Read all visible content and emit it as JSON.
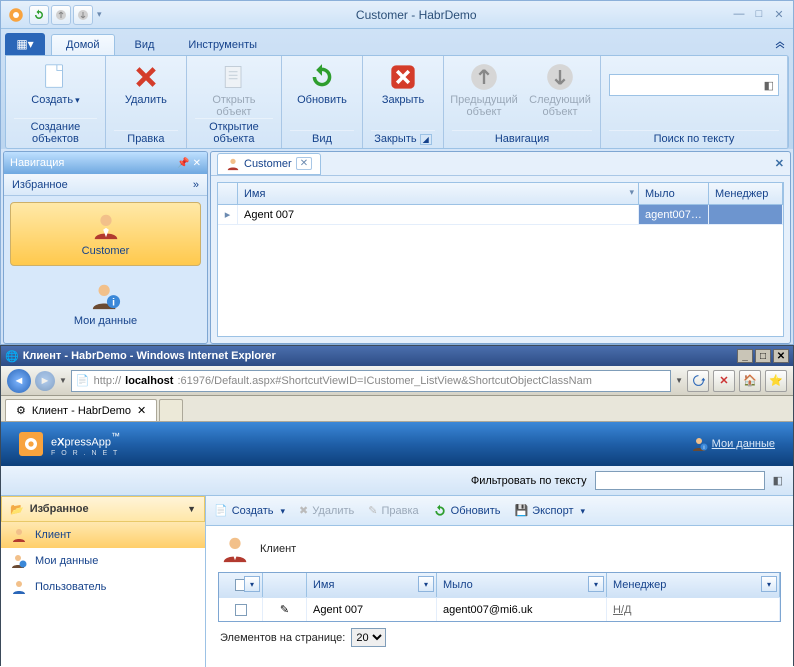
{
  "win": {
    "title": "Customer - HabrDemo",
    "tabs": {
      "home": "Домой",
      "view": "Вид",
      "tools": "Инструменты"
    },
    "groups": {
      "create": {
        "btn": "Создать",
        "title": "Создание объектов"
      },
      "edit": {
        "btn": "Удалить",
        "title": "Правка"
      },
      "open": {
        "btn": "Открыть\nобъект",
        "title": "Открытие объекта"
      },
      "view": {
        "refresh": "Обновить",
        "title": "Вид"
      },
      "close": {
        "btn": "Закрыть",
        "title": "Закрыть"
      },
      "nav": {
        "prev": "Предыдущий\nобъект",
        "next": "Следующий\nобъект",
        "title": "Навигация"
      },
      "search": {
        "title": "Поиск по тексту"
      }
    },
    "nav": {
      "header": "Навигация",
      "group": "Избранное",
      "items": [
        "Customer",
        "Мои данные"
      ]
    },
    "doc": {
      "tab": "Customer"
    },
    "grid": {
      "cols": [
        "Имя",
        "Мыло",
        "Менеджер"
      ],
      "row": {
        "name": "Agent 007",
        "mail": "agent007…"
      }
    }
  },
  "ie": {
    "title": "Клиент - HabrDemo - Windows Internet Explorer",
    "url_prefix": "http://",
    "url_host": "localhost",
    "url_rest": ":61976/Default.aspx#ShortcutViewID=ICustomer_ListView&ShortcutObjectClassNam",
    "tab": "Клиент - HabrDemo",
    "brand": {
      "e": "e",
      "x": "X",
      "rest": "pressApp",
      "tm": "™",
      "sub": "F O R   . N E T"
    },
    "userlink": "Мои данные",
    "filter": {
      "label": "Фильтровать по тексту"
    },
    "side": {
      "group": "Избранное",
      "items": [
        "Клиент",
        "Мои данные",
        "Пользователь"
      ]
    },
    "toolbar": {
      "create": "Создать",
      "delete": "Удалить",
      "edit": "Правка",
      "refresh": "Обновить",
      "export": "Экспорт"
    },
    "page_title": "Клиент",
    "wgrid": {
      "cols": [
        "Имя",
        "Мыло",
        "Менеджер"
      ],
      "row": {
        "name": "Agent 007",
        "mail": "agent007@mi6.uk",
        "mgr": "Н/Д"
      }
    },
    "pager": {
      "label": "Элементов на странице:",
      "value": "20"
    }
  }
}
